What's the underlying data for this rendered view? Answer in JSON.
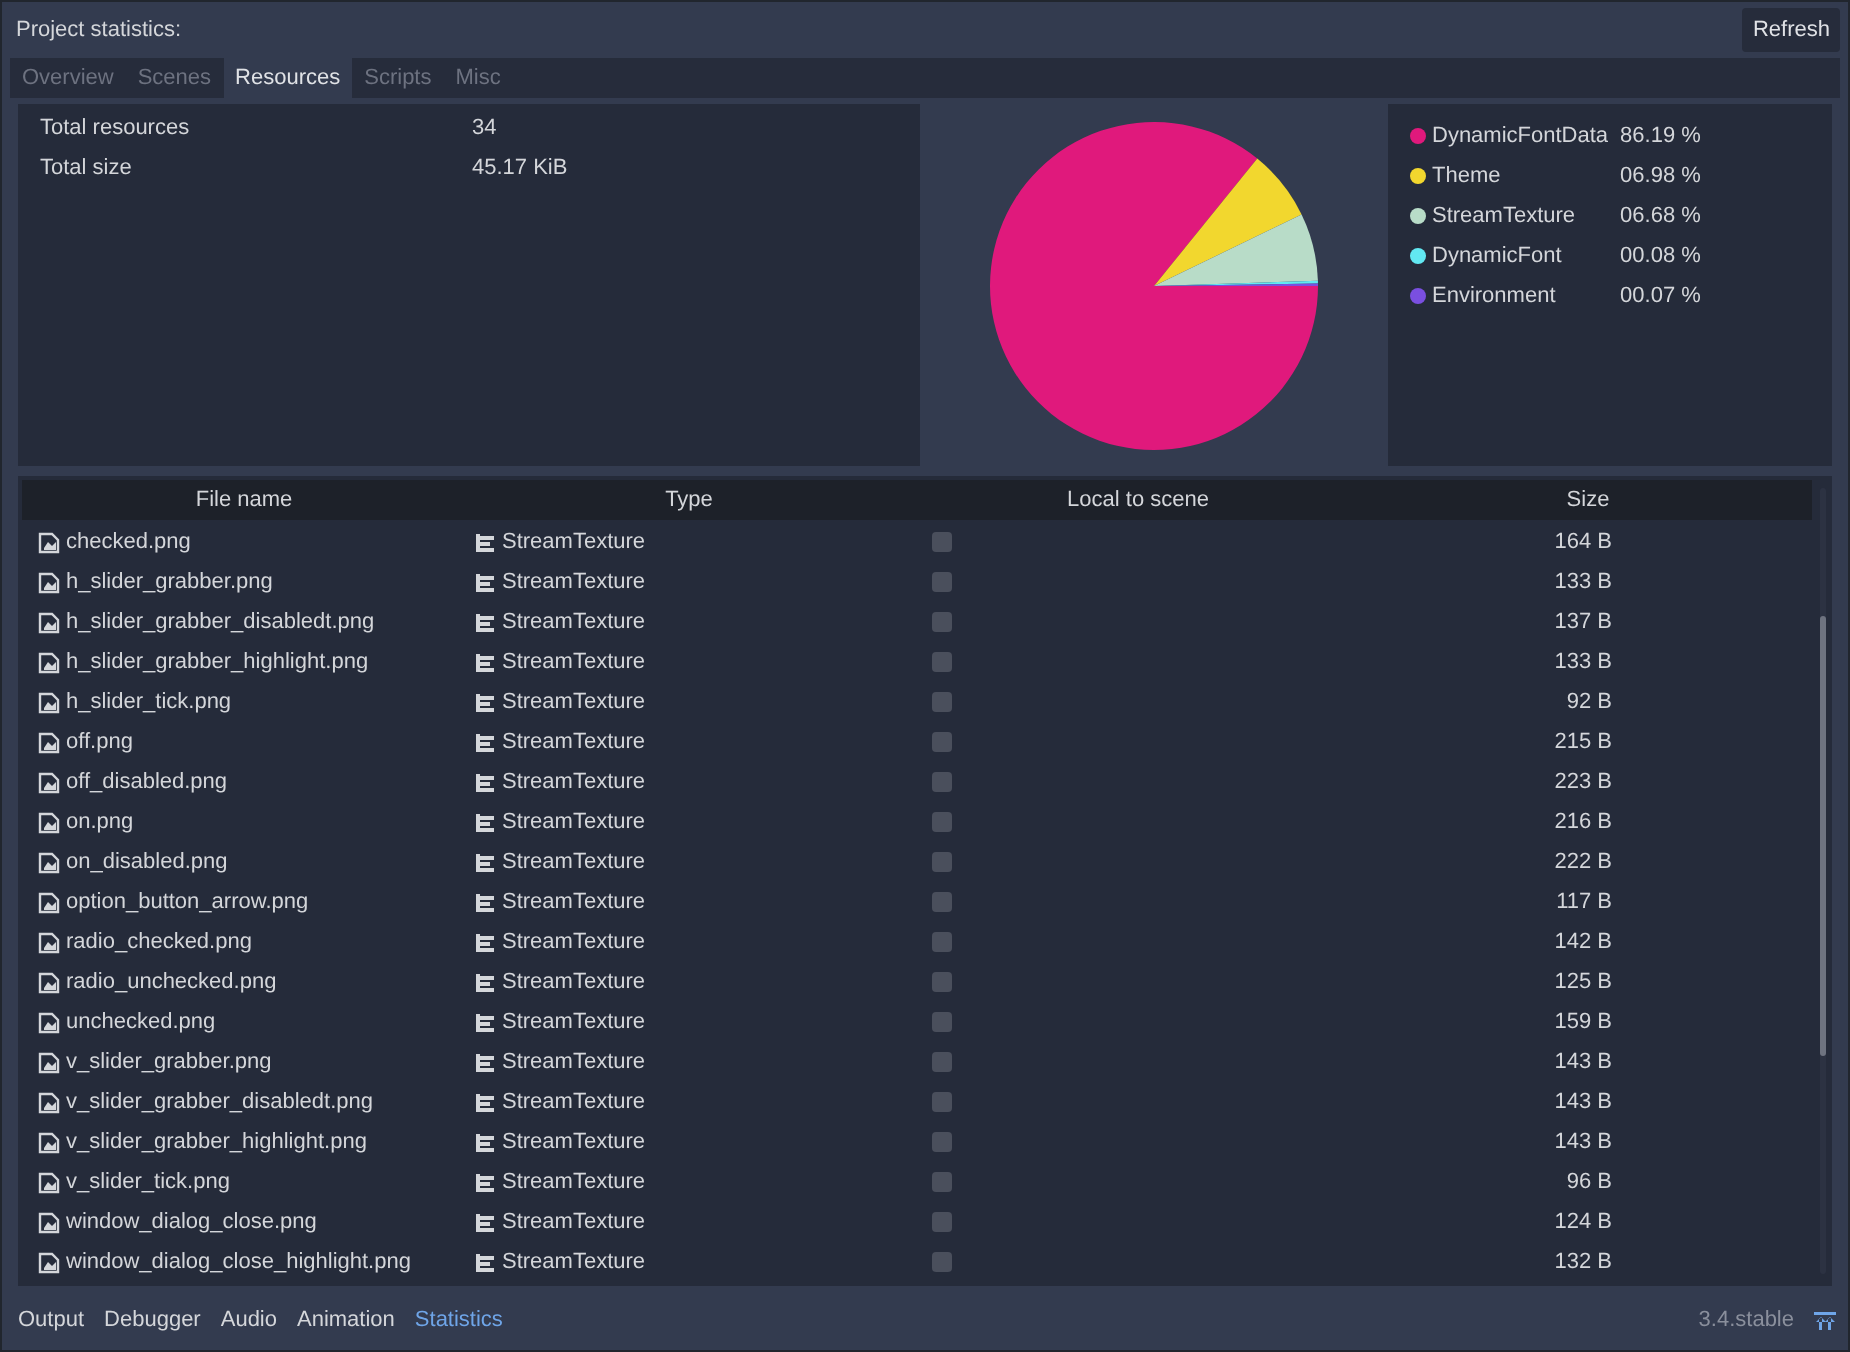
{
  "title": "Project statistics:",
  "refresh_button": "Refresh",
  "tabs": [
    {
      "label": "Overview",
      "selected": false
    },
    {
      "label": "Scenes",
      "selected": false
    },
    {
      "label": "Resources",
      "selected": true
    },
    {
      "label": "Scripts",
      "selected": false
    },
    {
      "label": "Misc",
      "selected": false
    }
  ],
  "summary": [
    {
      "label": "Total resources",
      "value": "34"
    },
    {
      "label": "Total size",
      "value": "45.17 KiB"
    }
  ],
  "chart_data": {
    "type": "pie",
    "categories": [
      "DynamicFontData",
      "Theme",
      "StreamTexture",
      "DynamicFont",
      "Environment"
    ],
    "values": [
      86.19,
      6.98,
      6.68,
      0.08,
      0.07
    ]
  },
  "legend": [
    {
      "color": "#e0197c",
      "percent": "86.19 %"
    },
    {
      "color": "#f2d72e",
      "percent": "06.98 %"
    },
    {
      "color": "#b8dcc8",
      "percent": "06.68 %"
    },
    {
      "color": "#62e8f2",
      "percent": "00.08 %"
    },
    {
      "color": "#7a4fe0",
      "percent": "00.07 %"
    }
  ],
  "table": {
    "columns": [
      "File name",
      "Type",
      "Local to scene",
      "Size"
    ],
    "rows": [
      {
        "file_name": "checked.png",
        "type": "StreamTexture",
        "local_to_scene": false,
        "size": "164 B"
      },
      {
        "file_name": "h_slider_grabber.png",
        "type": "StreamTexture",
        "local_to_scene": false,
        "size": "133 B"
      },
      {
        "file_name": "h_slider_grabber_disabledt.png",
        "type": "StreamTexture",
        "local_to_scene": false,
        "size": "137 B"
      },
      {
        "file_name": "h_slider_grabber_highlight.png",
        "type": "StreamTexture",
        "local_to_scene": false,
        "size": "133 B"
      },
      {
        "file_name": "h_slider_tick.png",
        "type": "StreamTexture",
        "local_to_scene": false,
        "size": "92 B"
      },
      {
        "file_name": "off.png",
        "type": "StreamTexture",
        "local_to_scene": false,
        "size": "215 B"
      },
      {
        "file_name": "off_disabled.png",
        "type": "StreamTexture",
        "local_to_scene": false,
        "size": "223 B"
      },
      {
        "file_name": "on.png",
        "type": "StreamTexture",
        "local_to_scene": false,
        "size": "216 B"
      },
      {
        "file_name": "on_disabled.png",
        "type": "StreamTexture",
        "local_to_scene": false,
        "size": "222 B"
      },
      {
        "file_name": "option_button_arrow.png",
        "type": "StreamTexture",
        "local_to_scene": false,
        "size": "117 B"
      },
      {
        "file_name": "radio_checked.png",
        "type": "StreamTexture",
        "local_to_scene": false,
        "size": "142 B"
      },
      {
        "file_name": "radio_unchecked.png",
        "type": "StreamTexture",
        "local_to_scene": false,
        "size": "125 B"
      },
      {
        "file_name": "unchecked.png",
        "type": "StreamTexture",
        "local_to_scene": false,
        "size": "159 B"
      },
      {
        "file_name": "v_slider_grabber.png",
        "type": "StreamTexture",
        "local_to_scene": false,
        "size": "143 B"
      },
      {
        "file_name": "v_slider_grabber_disabledt.png",
        "type": "StreamTexture",
        "local_to_scene": false,
        "size": "143 B"
      },
      {
        "file_name": "v_slider_grabber_highlight.png",
        "type": "StreamTexture",
        "local_to_scene": false,
        "size": "143 B"
      },
      {
        "file_name": "v_slider_tick.png",
        "type": "StreamTexture",
        "local_to_scene": false,
        "size": "96 B"
      },
      {
        "file_name": "window_dialog_close.png",
        "type": "StreamTexture",
        "local_to_scene": false,
        "size": "124 B"
      },
      {
        "file_name": "window_dialog_close_highlight.png",
        "type": "StreamTexture",
        "local_to_scene": false,
        "size": "132 B"
      }
    ]
  },
  "bottom_tabs": [
    {
      "label": "Output",
      "selected": false
    },
    {
      "label": "Debugger",
      "selected": false
    },
    {
      "label": "Audio",
      "selected": false
    },
    {
      "label": "Animation",
      "selected": false
    },
    {
      "label": "Statistics",
      "selected": true
    }
  ],
  "version": "3.4.stable"
}
